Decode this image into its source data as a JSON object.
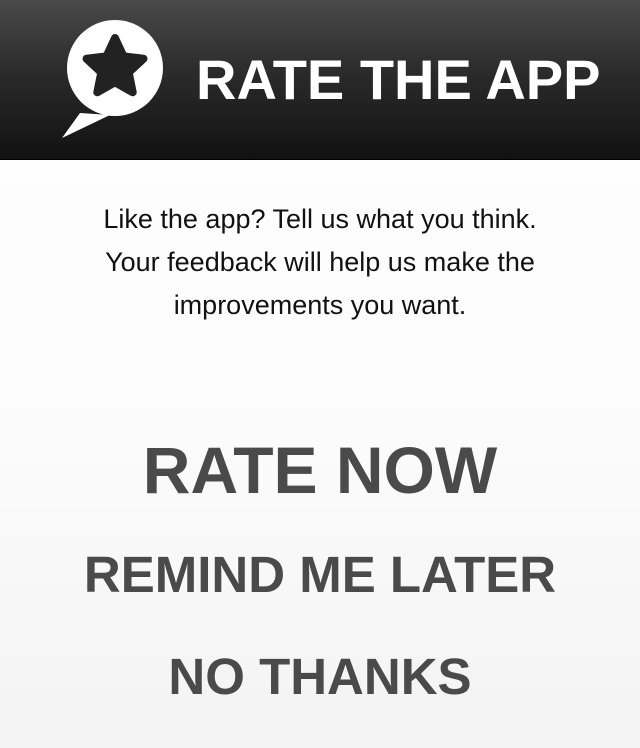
{
  "header": {
    "icon": "star-speech-bubble-icon",
    "title": "RATE THE APP"
  },
  "message": {
    "lines": [
      "Like the app? Tell us what you think.",
      "Your feedback will help us make the",
      "improvements you want."
    ]
  },
  "actions": {
    "rate_now": "RATE NOW",
    "remind_later": "REMIND ME LATER",
    "no_thanks": "NO THANKS"
  },
  "colors": {
    "header_background": "#2b2b2b",
    "header_text": "#ffffff",
    "body_text": "#111111",
    "action_text": "#4a4a4a"
  }
}
